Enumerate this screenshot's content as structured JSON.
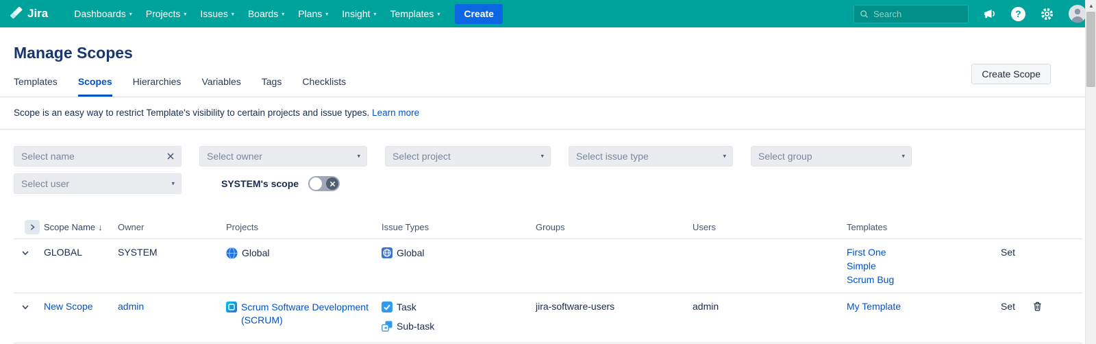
{
  "navbar": {
    "brand": "Jira",
    "menu_items": [
      {
        "label": "Dashboards"
      },
      {
        "label": "Projects"
      },
      {
        "label": "Issues"
      },
      {
        "label": "Boards"
      },
      {
        "label": "Plans"
      },
      {
        "label": "Insight"
      },
      {
        "label": "Templates"
      }
    ],
    "create_button": "Create",
    "search_placeholder": "Search"
  },
  "page": {
    "title": "Manage Scopes",
    "tabs": [
      {
        "label": "Templates",
        "active": false
      },
      {
        "label": "Scopes",
        "active": true
      },
      {
        "label": "Hierarchies",
        "active": false
      },
      {
        "label": "Variables",
        "active": false
      },
      {
        "label": "Tags",
        "active": false
      },
      {
        "label": "Checklists",
        "active": false
      }
    ],
    "create_scope_button": "Create Scope",
    "description": "Scope is an easy way to restrict Template's visibility to certain projects and issue types.",
    "learn_more_link": "Learn more"
  },
  "filters": {
    "name": {
      "placeholder": "Select name"
    },
    "owner": {
      "placeholder": "Select owner"
    },
    "project": {
      "placeholder": "Select project"
    },
    "issue_type": {
      "placeholder": "Select issue type"
    },
    "group": {
      "placeholder": "Select group"
    },
    "user": {
      "placeholder": "Select user"
    },
    "system_scope_label": "SYSTEM's scope"
  },
  "table": {
    "headers": {
      "scope_name": "Scope Name",
      "owner": "Owner",
      "projects": "Projects",
      "issue_types": "Issue Types",
      "groups": "Groups",
      "users": "Users",
      "templates": "Templates"
    },
    "rows": [
      {
        "scope_name": "GLOBAL",
        "owner": "SYSTEM",
        "projects": [
          {
            "label": "Global",
            "icon": "globe-icon"
          }
        ],
        "issue_types": [
          {
            "label": "Global",
            "icon": "global-issue-type-icon"
          }
        ],
        "groups": "",
        "users": "",
        "templates": [
          "First One",
          "Simple",
          "Scrum Bug"
        ],
        "set_label": "Set"
      },
      {
        "scope_name": "New Scope",
        "owner": "admin",
        "projects": [
          {
            "label": "Scrum Software Development (SCRUM)",
            "icon": "scrum-project-icon"
          }
        ],
        "issue_types": [
          {
            "label": "Task",
            "icon": "task-icon"
          },
          {
            "label": "Sub-task",
            "icon": "subtask-icon"
          }
        ],
        "groups": "jira-software-users",
        "users": "admin",
        "templates": [
          "My Template"
        ],
        "set_label": "Set"
      }
    ]
  },
  "colors": {
    "navbar_teal": "#00a29c",
    "link_blue": "#0052CC",
    "create_button_blue": "#0C66E4",
    "title_navy": "#17366d",
    "filter_background": "#ebecf0",
    "border_gray": "#dfe1e6"
  }
}
